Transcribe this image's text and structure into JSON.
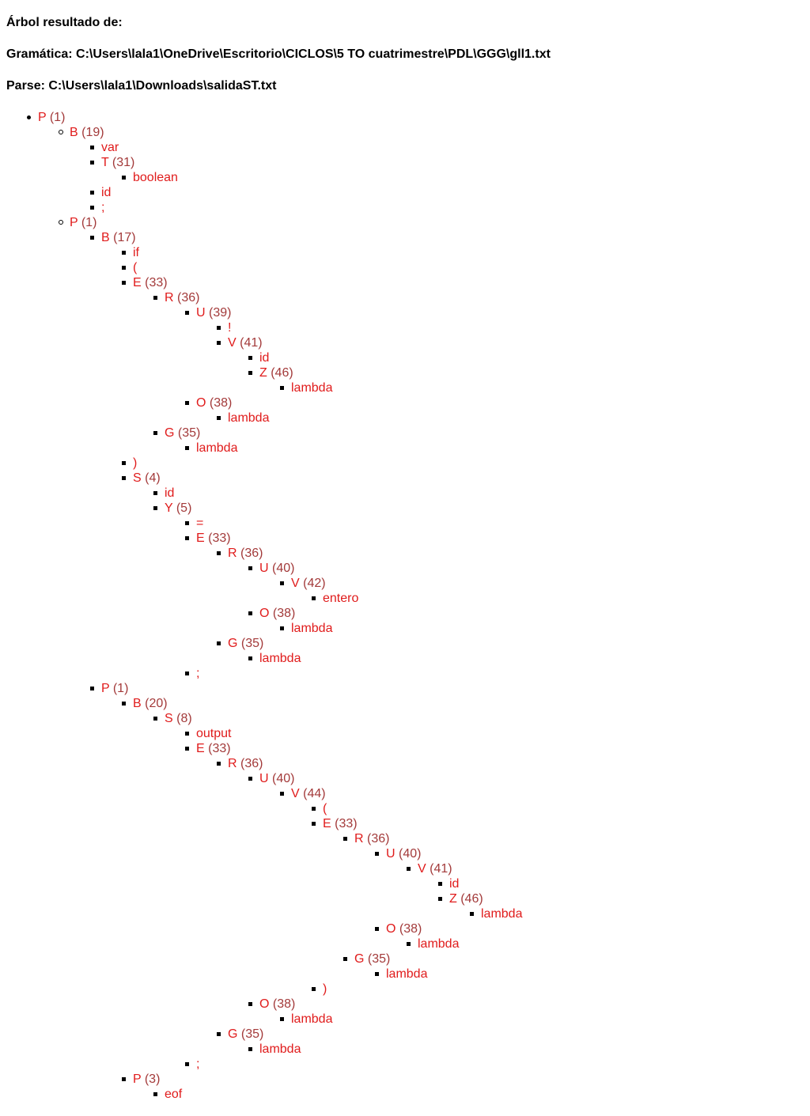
{
  "header": {
    "title": "Árbol resultado de:",
    "grammar": "Gramática: C:\\Users\\lala1\\OneDrive\\Escritorio\\CICLOS\\5 TO cuatrimestre\\PDL\\GGG\\gll1.txt",
    "parse": "Parse: C:\\Users\\lala1\\Downloads\\salidaST.txt"
  },
  "tree": [
    {
      "d": 0,
      "label": "P",
      "num": "(1)"
    },
    {
      "d": 1,
      "label": "B",
      "num": "(19)"
    },
    {
      "d": 2,
      "label": "var",
      "num": ""
    },
    {
      "d": 2,
      "label": "T",
      "num": "(31)"
    },
    {
      "d": 3,
      "label": "boolean",
      "num": ""
    },
    {
      "d": 2,
      "label": "id",
      "num": ""
    },
    {
      "d": 2,
      "label": ";",
      "num": ""
    },
    {
      "d": 1,
      "label": "P",
      "num": "(1)"
    },
    {
      "d": 2,
      "label": "B",
      "num": "(17)"
    },
    {
      "d": 3,
      "label": "if",
      "num": ""
    },
    {
      "d": 3,
      "label": "(",
      "num": ""
    },
    {
      "d": 3,
      "label": "E",
      "num": "(33)"
    },
    {
      "d": 4,
      "label": "R",
      "num": "(36)"
    },
    {
      "d": 5,
      "label": "U",
      "num": "(39)"
    },
    {
      "d": 6,
      "label": "!",
      "num": ""
    },
    {
      "d": 6,
      "label": "V",
      "num": "(41)"
    },
    {
      "d": 7,
      "label": "id",
      "num": ""
    },
    {
      "d": 7,
      "label": "Z",
      "num": "(46)"
    },
    {
      "d": 8,
      "label": "lambda",
      "num": ""
    },
    {
      "d": 5,
      "label": "O",
      "num": "(38)"
    },
    {
      "d": 6,
      "label": "lambda",
      "num": ""
    },
    {
      "d": 4,
      "label": "G",
      "num": "(35)"
    },
    {
      "d": 5,
      "label": "lambda",
      "num": ""
    },
    {
      "d": 3,
      "label": ")",
      "num": ""
    },
    {
      "d": 3,
      "label": "S",
      "num": "(4)"
    },
    {
      "d": 4,
      "label": "id",
      "num": ""
    },
    {
      "d": 4,
      "label": "Y",
      "num": "(5)"
    },
    {
      "d": 5,
      "label": "=",
      "num": ""
    },
    {
      "d": 5,
      "label": "E",
      "num": "(33)"
    },
    {
      "d": 6,
      "label": "R",
      "num": "(36)"
    },
    {
      "d": 7,
      "label": "U",
      "num": "(40)"
    },
    {
      "d": 8,
      "label": "V",
      "num": "(42)"
    },
    {
      "d": 9,
      "label": "entero",
      "num": ""
    },
    {
      "d": 7,
      "label": "O",
      "num": "(38)"
    },
    {
      "d": 8,
      "label": "lambda",
      "num": ""
    },
    {
      "d": 6,
      "label": "G",
      "num": "(35)"
    },
    {
      "d": 7,
      "label": "lambda",
      "num": ""
    },
    {
      "d": 5,
      "label": ";",
      "num": ""
    },
    {
      "d": 2,
      "label": "P",
      "num": "(1)"
    },
    {
      "d": 3,
      "label": "B",
      "num": "(20)"
    },
    {
      "d": 4,
      "label": "S",
      "num": "(8)"
    },
    {
      "d": 5,
      "label": "output",
      "num": ""
    },
    {
      "d": 5,
      "label": "E",
      "num": "(33)"
    },
    {
      "d": 6,
      "label": "R",
      "num": "(36)"
    },
    {
      "d": 7,
      "label": "U",
      "num": "(40)"
    },
    {
      "d": 8,
      "label": "V",
      "num": "(44)"
    },
    {
      "d": 9,
      "label": "(",
      "num": ""
    },
    {
      "d": 9,
      "label": "E",
      "num": "(33)"
    },
    {
      "d": 10,
      "label": "R",
      "num": "(36)"
    },
    {
      "d": 11,
      "label": "U",
      "num": "(40)"
    },
    {
      "d": 12,
      "label": "V",
      "num": "(41)"
    },
    {
      "d": 13,
      "label": "id",
      "num": ""
    },
    {
      "d": 13,
      "label": "Z",
      "num": "(46)"
    },
    {
      "d": 14,
      "label": "lambda",
      "num": ""
    },
    {
      "d": 11,
      "label": "O",
      "num": "(38)"
    },
    {
      "d": 12,
      "label": "lambda",
      "num": ""
    },
    {
      "d": 10,
      "label": "G",
      "num": "(35)"
    },
    {
      "d": 11,
      "label": "lambda",
      "num": ""
    },
    {
      "d": 9,
      "label": ")",
      "num": ""
    },
    {
      "d": 7,
      "label": "O",
      "num": "(38)"
    },
    {
      "d": 8,
      "label": "lambda",
      "num": ""
    },
    {
      "d": 6,
      "label": "G",
      "num": "(35)"
    },
    {
      "d": 7,
      "label": "lambda",
      "num": ""
    },
    {
      "d": 5,
      "label": ";",
      "num": ""
    },
    {
      "d": 3,
      "label": "P",
      "num": "(3)"
    },
    {
      "d": 4,
      "label": "eof",
      "num": ""
    }
  ]
}
